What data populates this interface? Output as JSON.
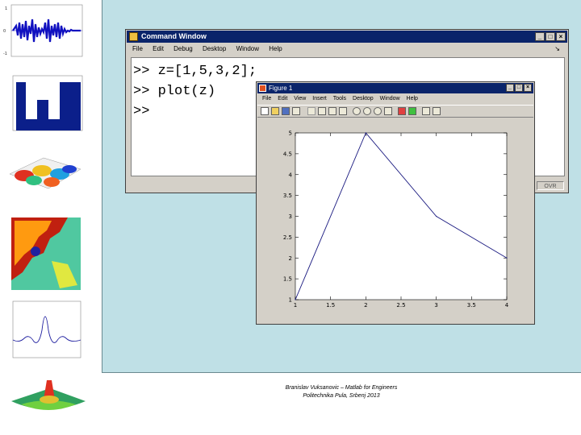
{
  "command_window": {
    "title": "Command Window",
    "menu": [
      "File",
      "Edit",
      "Debug",
      "Desktop",
      "Window",
      "Help"
    ],
    "lines": [
      ">> z=[1,5,3,2];",
      ">> plot(z)",
      ">>"
    ],
    "status_indicator": "OVR"
  },
  "figure_window": {
    "title": "Figure 1",
    "menu": [
      "File",
      "Edit",
      "View",
      "Insert",
      "Tools",
      "Desktop",
      "Window",
      "Help"
    ]
  },
  "chart_data": {
    "type": "line",
    "x": [
      1,
      2,
      3,
      4
    ],
    "y": [
      1,
      5,
      3,
      2
    ],
    "xlim": [
      1,
      4
    ],
    "ylim": [
      1,
      5
    ],
    "xticks": [
      "1",
      "1.5",
      "2",
      "2.5",
      "3",
      "3.5",
      "4"
    ],
    "yticks": [
      "1",
      "1.5",
      "2",
      "2.5",
      "3",
      "3.5",
      "4",
      "4.5",
      "5"
    ],
    "grid": false,
    "line_color": "#1a1a80"
  },
  "footer": {
    "line1": "Branislav Vuksanovic – Matlab for Engineers",
    "line2": "Politechnika Pula, Srbenj 2013"
  }
}
